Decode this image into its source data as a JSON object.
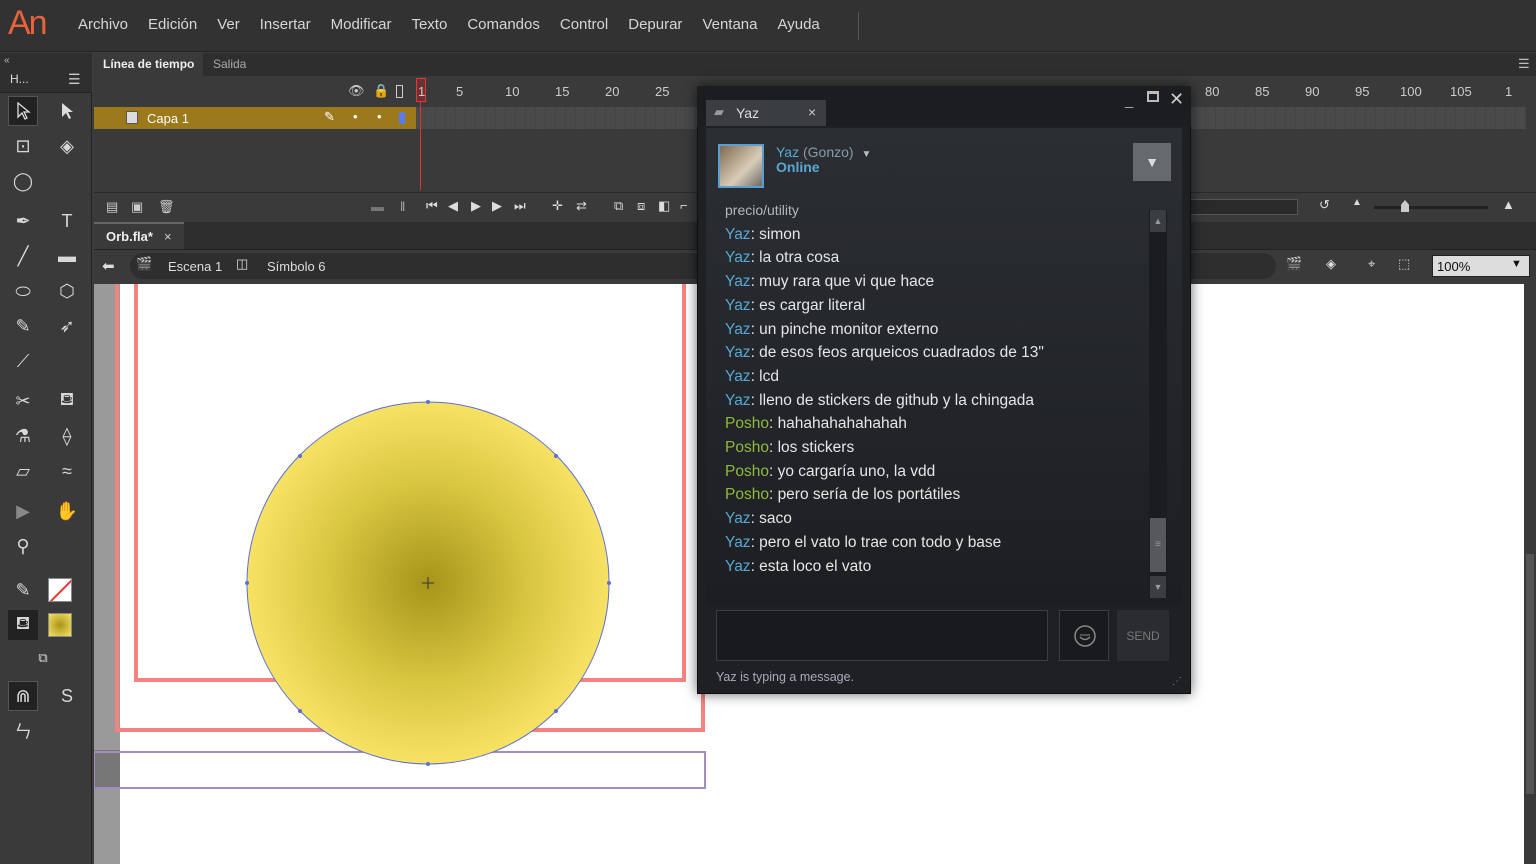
{
  "app": {
    "logo": "An"
  },
  "menu": [
    "Archivo",
    "Edición",
    "Ver",
    "Insertar",
    "Modificar",
    "Texto",
    "Comandos",
    "Control",
    "Depurar",
    "Ventana",
    "Ayuda"
  ],
  "toolpanel": {
    "header": "H..."
  },
  "timeline": {
    "tabs": [
      "Línea de tiempo",
      "Salida"
    ],
    "ruler": [
      "1",
      "5",
      "10",
      "15",
      "20",
      "25",
      "80",
      "85",
      "90",
      "95",
      "100",
      "105",
      "1"
    ],
    "layer": "Capa 1"
  },
  "document": {
    "tab": "Orb.fla*",
    "scene": "Escena 1",
    "symbol": "Símbolo 6",
    "zoom": "100%"
  },
  "colors": {
    "accent": "#9c7a1c",
    "fill_gradient_center": "#a6951a",
    "fill_gradient_edge": "#f8e264",
    "stroke": "#5a6fd8",
    "frame_red": "#f38380",
    "frame_purple": "#a38cc4"
  },
  "chat": {
    "tab": "Yaz",
    "contact_name": "Yaz",
    "contact_alias": "(Gonzo)",
    "status": "Online",
    "messages": [
      {
        "who": "",
        "text": "precio/utility",
        "partial": true
      },
      {
        "who": "Yaz",
        "text": ": simon"
      },
      {
        "who": "Yaz",
        "text": ": la otra cosa"
      },
      {
        "who": "Yaz",
        "text": ": muy rara que vi que hace"
      },
      {
        "who": "Yaz",
        "text": ": es cargar literal"
      },
      {
        "who": "Yaz",
        "text": ": un pinche monitor externo"
      },
      {
        "who": "Yaz",
        "text": ": de esos feos arqueicos cuadrados de 13\""
      },
      {
        "who": "Yaz",
        "text": ": lcd"
      },
      {
        "who": "Yaz",
        "text": ": lleno de stickers de github y la chingada"
      },
      {
        "who": "Posho",
        "text": ": hahahahahahahah"
      },
      {
        "who": "Posho",
        "text": ": los stickers"
      },
      {
        "who": "Posho",
        "text": ": yo cargaría uno, la vdd"
      },
      {
        "who": "Posho",
        "text": ": pero sería de los portátiles"
      },
      {
        "who": "Yaz",
        "text": ": saco"
      },
      {
        "who": "Yaz",
        "text": ": pero el vato lo trae con todo y base"
      },
      {
        "who": "Yaz",
        "text": ": esta loco el vato"
      }
    ],
    "input_placeholder": "",
    "send_label": "SEND",
    "typing_status": "Yaz is typing a message."
  }
}
